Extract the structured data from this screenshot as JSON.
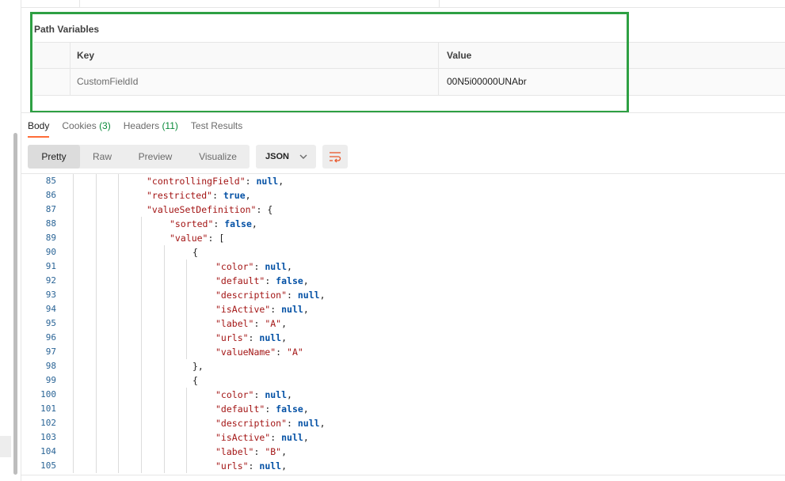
{
  "path_variables": {
    "title": "Path Variables",
    "columns": {
      "key": "Key",
      "value": "Value"
    },
    "rows": [
      {
        "key": "CustomFieldId",
        "value": "00N5i00000UNAbr"
      }
    ]
  },
  "response_tabs": [
    {
      "label": "Body",
      "count": ""
    },
    {
      "label": "Cookies",
      "count": "(3)"
    },
    {
      "label": "Headers",
      "count": "(11)"
    },
    {
      "label": "Test Results",
      "count": ""
    }
  ],
  "view_modes": [
    "Pretty",
    "Raw",
    "Preview",
    "Visualize"
  ],
  "active_view_mode": "Pretty",
  "format_select": {
    "value": "JSON"
  },
  "icons": {
    "wrap": "wrap-lines-icon",
    "chevron": "chevron-down-icon"
  },
  "colors": {
    "highlight_box": "#2ea043",
    "active_tab_underline": "#ff6c37",
    "count": "#0a8a3a"
  },
  "code_lines": [
    {
      "n": "85",
      "indent": 3,
      "tokens": [
        [
          "k",
          "\"controllingField\""
        ],
        [
          "p",
          ": "
        ],
        [
          "kw",
          "null"
        ],
        [
          "p",
          ","
        ]
      ]
    },
    {
      "n": "86",
      "indent": 3,
      "tokens": [
        [
          "k",
          "\"restricted\""
        ],
        [
          "p",
          ": "
        ],
        [
          "kw",
          "true"
        ],
        [
          "p",
          ","
        ]
      ]
    },
    {
      "n": "87",
      "indent": 3,
      "tokens": [
        [
          "k",
          "\"valueSetDefinition\""
        ],
        [
          "p",
          ": {"
        ]
      ]
    },
    {
      "n": "88",
      "indent": 4,
      "tokens": [
        [
          "k",
          "\"sorted\""
        ],
        [
          "p",
          ": "
        ],
        [
          "kw",
          "false"
        ],
        [
          "p",
          ","
        ]
      ]
    },
    {
      "n": "89",
      "indent": 4,
      "tokens": [
        [
          "k",
          "\"value\""
        ],
        [
          "p",
          ": ["
        ]
      ]
    },
    {
      "n": "90",
      "indent": 5,
      "tokens": [
        [
          "p",
          "{"
        ]
      ]
    },
    {
      "n": "91",
      "indent": 6,
      "tokens": [
        [
          "k",
          "\"color\""
        ],
        [
          "p",
          ": "
        ],
        [
          "kw",
          "null"
        ],
        [
          "p",
          ","
        ]
      ]
    },
    {
      "n": "92",
      "indent": 6,
      "tokens": [
        [
          "k",
          "\"default\""
        ],
        [
          "p",
          ": "
        ],
        [
          "kw",
          "false"
        ],
        [
          "p",
          ","
        ]
      ]
    },
    {
      "n": "93",
      "indent": 6,
      "tokens": [
        [
          "k",
          "\"description\""
        ],
        [
          "p",
          ": "
        ],
        [
          "kw",
          "null"
        ],
        [
          "p",
          ","
        ]
      ]
    },
    {
      "n": "94",
      "indent": 6,
      "tokens": [
        [
          "k",
          "\"isActive\""
        ],
        [
          "p",
          ": "
        ],
        [
          "kw",
          "null"
        ],
        [
          "p",
          ","
        ]
      ]
    },
    {
      "n": "95",
      "indent": 6,
      "tokens": [
        [
          "k",
          "\"label\""
        ],
        [
          "p",
          ": "
        ],
        [
          "s",
          "\"A\""
        ],
        [
          "p",
          ","
        ]
      ]
    },
    {
      "n": "96",
      "indent": 6,
      "tokens": [
        [
          "k",
          "\"urls\""
        ],
        [
          "p",
          ": "
        ],
        [
          "kw",
          "null"
        ],
        [
          "p",
          ","
        ]
      ]
    },
    {
      "n": "97",
      "indent": 6,
      "tokens": [
        [
          "k",
          "\"valueName\""
        ],
        [
          "p",
          ": "
        ],
        [
          "s",
          "\"A\""
        ]
      ]
    },
    {
      "n": "98",
      "indent": 5,
      "tokens": [
        [
          "p",
          "},"
        ]
      ]
    },
    {
      "n": "99",
      "indent": 5,
      "tokens": [
        [
          "p",
          "{"
        ]
      ]
    },
    {
      "n": "100",
      "indent": 6,
      "tokens": [
        [
          "k",
          "\"color\""
        ],
        [
          "p",
          ": "
        ],
        [
          "kw",
          "null"
        ],
        [
          "p",
          ","
        ]
      ]
    },
    {
      "n": "101",
      "indent": 6,
      "tokens": [
        [
          "k",
          "\"default\""
        ],
        [
          "p",
          ": "
        ],
        [
          "kw",
          "false"
        ],
        [
          "p",
          ","
        ]
      ]
    },
    {
      "n": "102",
      "indent": 6,
      "tokens": [
        [
          "k",
          "\"description\""
        ],
        [
          "p",
          ": "
        ],
        [
          "kw",
          "null"
        ],
        [
          "p",
          ","
        ]
      ]
    },
    {
      "n": "103",
      "indent": 6,
      "tokens": [
        [
          "k",
          "\"isActive\""
        ],
        [
          "p",
          ": "
        ],
        [
          "kw",
          "null"
        ],
        [
          "p",
          ","
        ]
      ]
    },
    {
      "n": "104",
      "indent": 6,
      "tokens": [
        [
          "k",
          "\"label\""
        ],
        [
          "p",
          ": "
        ],
        [
          "s",
          "\"B\""
        ],
        [
          "p",
          ","
        ]
      ]
    },
    {
      "n": "105",
      "indent": 6,
      "tokens": [
        [
          "k",
          "\"urls\""
        ],
        [
          "p",
          ": "
        ],
        [
          "kw",
          "null"
        ],
        [
          "p",
          ","
        ]
      ]
    }
  ]
}
